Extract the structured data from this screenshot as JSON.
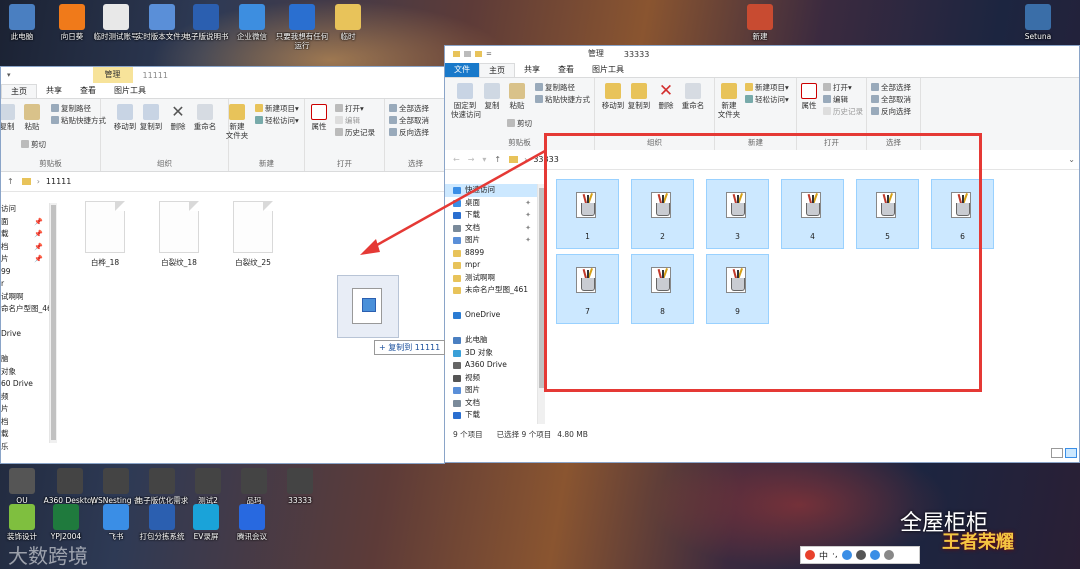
{
  "desktop": {
    "top_icons": [
      {
        "label": "此电脑",
        "color": "#4a7fc1"
      },
      {
        "label": "向日葵",
        "color": "#f07a1a"
      },
      {
        "label": "临时测试账号",
        "color": "#e8e8e8"
      },
      {
        "label": "实时版本文件夹",
        "color": "#5a8fd8"
      },
      {
        "label": "电子版说明书",
        "color": "#2b5fb0"
      },
      {
        "label": "企业微信",
        "color": "#3d8ee0"
      },
      {
        "label": "只要我想有任何运行",
        "color": "#2a6fd0"
      },
      {
        "label": "临时",
        "color": "#e8c35a"
      }
    ],
    "top_right_icons": [
      {
        "label": "新建",
        "color": "#c84b31"
      },
      {
        "label": "Setuna",
        "color": "#3a6ea8"
      }
    ],
    "bottom_icons": [
      {
        "label": "OU",
        "color": "#555"
      },
      {
        "label": "A360 Desktop",
        "color": "#444"
      },
      {
        "label": "WSNesting 备份",
        "color": "#444"
      },
      {
        "label": "电子版优化需求",
        "color": "#444"
      },
      {
        "label": "测试2",
        "color": "#444"
      },
      {
        "label": "品玛",
        "color": "#444"
      },
      {
        "label": "33333",
        "color": "#444"
      }
    ],
    "dock_icons": [
      {
        "label": "装饰设计",
        "color": "#7fbf3f"
      },
      {
        "label": "YPJ2004",
        "color": "#1f7a3d"
      },
      {
        "label": "飞书",
        "color": "#3a8ee6"
      },
      {
        "label": "打包分拣系统",
        "color": "#2b5fb0"
      },
      {
        "label": "EV录屏",
        "color": "#1aa3d9"
      },
      {
        "label": "腾讯会议",
        "color": "#2869e0"
      }
    ],
    "watermark_left": "大数跨境",
    "watermark_right": "全屋柜柜",
    "game_logo": "王者荣耀"
  },
  "left_window": {
    "manage_label": "管理",
    "folder_title": "11111",
    "tabs": [
      "主页",
      "共享",
      "查看",
      "图片工具"
    ],
    "ribbon": {
      "clipboard": {
        "copy": "复制",
        "paste": "粘贴",
        "copy_path": "复制路径",
        "paste_shortcut": "粘贴快捷方式",
        "cut": "剪切",
        "group": "剪贴板"
      },
      "organize": {
        "move_to": "移动到",
        "copy_to": "复制到",
        "delete": "删除",
        "rename": "重命名",
        "group": "组织"
      },
      "new": {
        "new_folder": "新建\n文件夹",
        "new_item": "新建项目",
        "easy_access": "轻松访问",
        "group": "新建"
      },
      "open": {
        "properties": "属性",
        "open": "打开",
        "edit": "编辑",
        "history": "历史记录",
        "group": "打开"
      },
      "select": {
        "select_all": "全部选择",
        "select_none": "全部取消",
        "invert": "反向选择",
        "group": "选择"
      }
    },
    "address": "11111",
    "nav_items": [
      "访问",
      "面",
      "载",
      "档",
      "片",
      "99",
      "r",
      "试啊啊",
      "命名户型图_461",
      "",
      "Drive",
      "",
      "脑",
      "对象",
      "60 Drive",
      "频",
      "片",
      "档",
      "载",
      "乐"
    ],
    "files": [
      {
        "name": "白桦_18"
      },
      {
        "name": "白裂纹_18"
      },
      {
        "name": "白裂纹_25"
      }
    ]
  },
  "drag": {
    "tooltip": "+ 复制到 11111"
  },
  "right_window": {
    "manage_label": "管理",
    "folder_title": "33333",
    "tabs": [
      "文件",
      "主页",
      "共享",
      "查看",
      "图片工具"
    ],
    "ribbon": {
      "clipboard": {
        "pin": "固定到\n快速访问",
        "copy": "复制",
        "paste": "粘贴",
        "copy_path": "复制路径",
        "paste_shortcut": "粘贴快捷方式",
        "cut": "剪切",
        "group": "剪贴板"
      },
      "organize": {
        "move_to": "移动到",
        "copy_to": "复制到",
        "delete": "删除",
        "rename": "重命名",
        "group": "组织"
      },
      "new": {
        "new_folder": "新建\n文件夹",
        "new_item": "新建项目",
        "easy_access": "轻松访问",
        "group": "新建"
      },
      "open": {
        "properties": "属性",
        "open": "打开",
        "edit": "编辑",
        "history": "历史记录",
        "group": "打开"
      },
      "select": {
        "select_all": "全部选择",
        "select_none": "全部取消",
        "invert": "反向选择",
        "group": "选择"
      }
    },
    "address": "33333",
    "nav_items": [
      {
        "label": "快速访问",
        "color": "#3a8ee6",
        "pin": false,
        "sel": true
      },
      {
        "label": "桌面",
        "color": "#3a8ee6",
        "pin": true
      },
      {
        "label": "下载",
        "color": "#2a6fd0",
        "pin": true
      },
      {
        "label": "文档",
        "color": "#7a8a9a",
        "pin": true
      },
      {
        "label": "图片",
        "color": "#5a8fd8",
        "pin": true
      },
      {
        "label": "8899",
        "color": "#e8c35a"
      },
      {
        "label": "mpr",
        "color": "#e8c35a"
      },
      {
        "label": "测试啊啊",
        "color": "#e8c35a"
      },
      {
        "label": "未命名户型图_461",
        "color": "#e8c35a"
      },
      {
        "label": "",
        "color": ""
      },
      {
        "label": "OneDrive",
        "color": "#2b7cd3"
      },
      {
        "label": "",
        "color": ""
      },
      {
        "label": "此电脑",
        "color": "#4a7fc1"
      },
      {
        "label": "3D 对象",
        "color": "#3aa0d8"
      },
      {
        "label": "A360 Drive",
        "color": "#666"
      },
      {
        "label": "视频",
        "color": "#555"
      },
      {
        "label": "图片",
        "color": "#5a8fd8"
      },
      {
        "label": "文档",
        "color": "#7a8a9a"
      },
      {
        "label": "下载",
        "color": "#2a6fd0"
      }
    ],
    "files": [
      "1",
      "2",
      "3",
      "4",
      "5",
      "6",
      "7",
      "8",
      "9"
    ],
    "status": {
      "count": "9 个项目",
      "selected": "已选择 9 个项目",
      "size": "4.80 MB"
    }
  },
  "tray": {
    "ime": "中",
    "punct": "·,"
  },
  "colors": {
    "highlight_red": "#e53935",
    "arrow_red": "#e53935",
    "selection_blue": "#cce8ff"
  }
}
